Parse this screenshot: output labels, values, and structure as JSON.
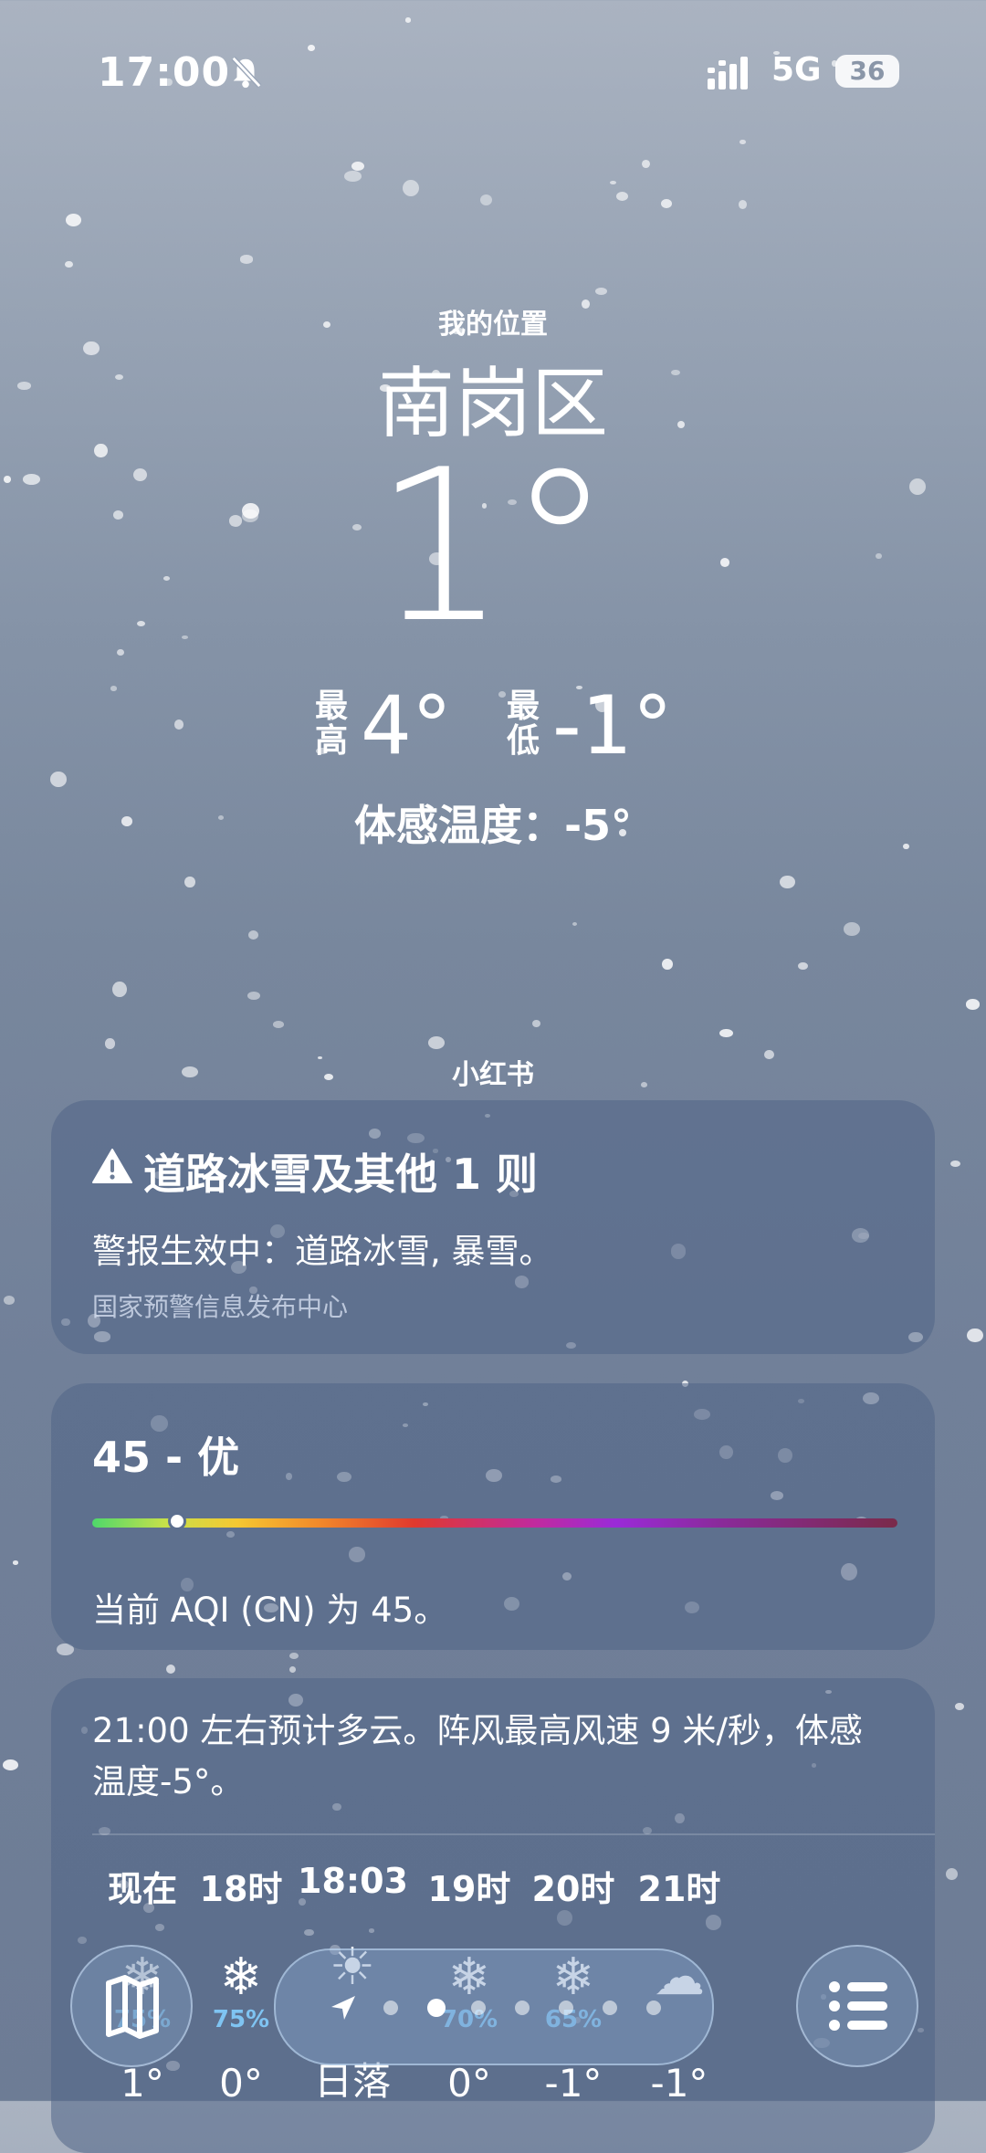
{
  "status_bar": {
    "time": "17:00",
    "network": "5G",
    "battery": "36"
  },
  "header": {
    "location_label": "我的位置",
    "city": "南岗区",
    "temperature": "1°",
    "high_label": "最高",
    "high": "4°",
    "low_label": "最低",
    "low": "-1°",
    "feels_like": "体感温度：-5°"
  },
  "source": "小红书",
  "alert": {
    "title": "道路冰雪及其他 1 则",
    "text": "警报生效中：道路冰雪, 暴雪。",
    "issuer": "国家预警信息发布中心"
  },
  "aqi": {
    "title": "45 - 优",
    "value": 45,
    "description": "当前 AQI (CN) 为 45。"
  },
  "forecast": {
    "summary": "21:00 左右预计多云。阵风最高风速 9 米/秒，体感温度-5°。",
    "hours": [
      {
        "label": "现在",
        "icon": "snow-icon",
        "pct": "75%",
        "temp": "1°"
      },
      {
        "label": "18时",
        "icon": "snow-icon",
        "pct": "75%",
        "temp": "0°"
      },
      {
        "label": "18:03",
        "icon": "sunset-icon",
        "pct": "",
        "temp": "日落"
      },
      {
        "label": "19时",
        "icon": "snow-icon",
        "pct": "70%",
        "temp": "0°"
      },
      {
        "label": "20时",
        "icon": "snow-icon",
        "pct": "65%",
        "temp": "-1°"
      },
      {
        "label": "21时",
        "icon": "cloud-icon",
        "pct": "",
        "temp": "-1°"
      }
    ]
  },
  "nav": {
    "page_count": 7,
    "active_page": 1
  }
}
